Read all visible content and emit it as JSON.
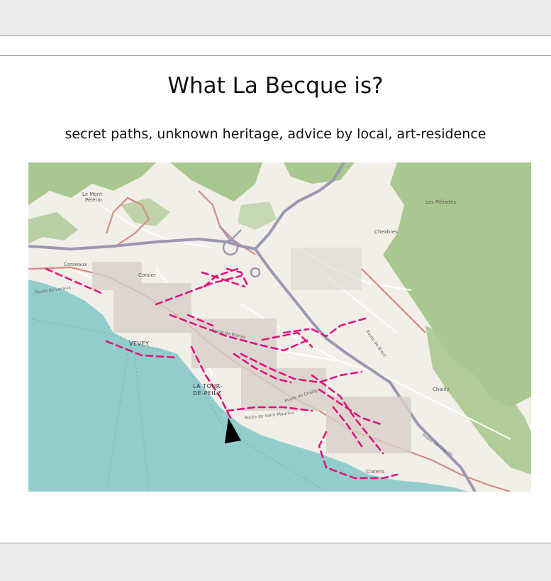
{
  "slide": {
    "title": "What La Becque is?",
    "subtitle": "secret paths, unknown heritage, advice by local, art-residence"
  },
  "map": {
    "icon": "location-arrow-icon",
    "colors": {
      "lake": "#93cccd",
      "land": "#f2efe9",
      "forest": "#a9c890",
      "motorway": "#9b97b3",
      "main_road": "#d88a80",
      "path": "#e0147e",
      "marker": "#000000"
    },
    "labels": {
      "vevey": "VEVEY",
      "la_tour": "LA TOUR-",
      "la_tour_2": "DE-PEILZ",
      "corseaux": "Corseaux",
      "corsier": "Corsier",
      "le_mont_pelerin": "Le Mont-",
      "le_mont_pelerin_2": "Pèlerin",
      "chexbres": "Chexbres",
      "chailly": "Chailly",
      "clarens": "Clarens",
      "route_de_blonay": "Route de Blonay",
      "route_de_brent": "Route de Brent",
      "route_de_chailly": "Route de Chailly",
      "route_de_saint_maurice": "Route de Saint-Maurice",
      "route_de_chaulin": "Route de Chaulin",
      "route_de_lavaux": "Route de Lavaux",
      "les_pleiades": "Les Pléiades"
    }
  }
}
